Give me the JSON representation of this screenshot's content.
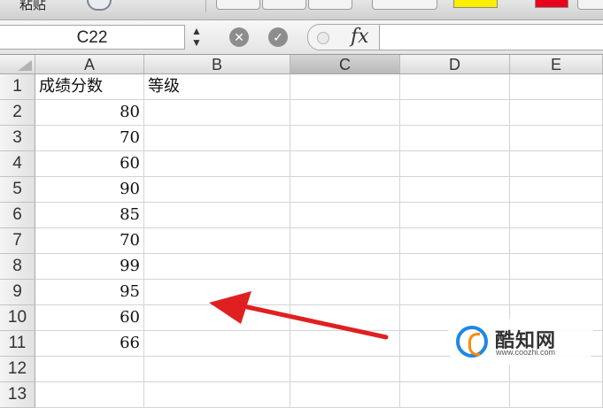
{
  "toolbar": {
    "paste_label": "粘贴",
    "swatch_colors": [
      "#ffee00",
      "#e8001c"
    ]
  },
  "formula_bar": {
    "name_box": "C22",
    "cancel_icon": "cancel-circle-icon",
    "confirm_icon": "check-circle-icon",
    "fx_label": "fx",
    "formula_value": ""
  },
  "sheet": {
    "columns": [
      "A",
      "B",
      "C",
      "D",
      "E"
    ],
    "active_column": "C",
    "rows": [
      {
        "num": "1",
        "A": "成绩分数",
        "B": "等级"
      },
      {
        "num": "2",
        "A": "80",
        "B": ""
      },
      {
        "num": "3",
        "A": "70",
        "B": ""
      },
      {
        "num": "4",
        "A": "60",
        "B": ""
      },
      {
        "num": "5",
        "A": "90",
        "B": ""
      },
      {
        "num": "6",
        "A": "85",
        "B": ""
      },
      {
        "num": "7",
        "A": "70",
        "B": ""
      },
      {
        "num": "8",
        "A": "99",
        "B": ""
      },
      {
        "num": "9",
        "A": "95",
        "B": ""
      },
      {
        "num": "10",
        "A": "60",
        "B": ""
      },
      {
        "num": "11",
        "A": "66",
        "B": ""
      },
      {
        "num": "12",
        "A": "",
        "B": ""
      },
      {
        "num": "13",
        "A": "",
        "B": ""
      }
    ]
  },
  "annotation": {
    "arrow_color": "#e02020",
    "arrow_icon": "red-arrow-pointer-icon"
  },
  "watermark": {
    "title": "酷知网",
    "url": "www.coozhi.com"
  }
}
